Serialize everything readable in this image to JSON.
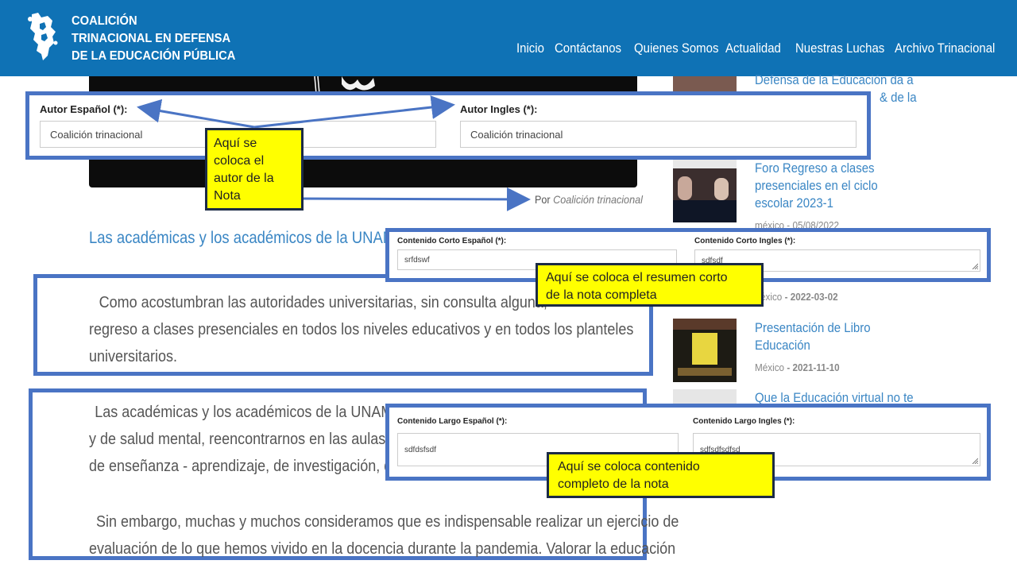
{
  "header": {
    "brand_lines": [
      "COALICIÓN",
      "TRINACIONAL EN DEFENSA",
      "DE LA EDUCACIÓN PÚBLICA"
    ],
    "nav": [
      "Inicio",
      "Contáctanos",
      "Quienes Somos",
      "Actualidad",
      "Nuestras Luchas",
      "Archivo Trinacional"
    ]
  },
  "article": {
    "byline_prefix": "Por",
    "byline_author": "Coalición trinacional",
    "title": "Las académicas y los académicos de la UNAM",
    "para1": [
      "Como acostumbran las autoridades universitarias, sin consulta alguna,",
      "regreso a clases presenciales en todos los niveles educativos y en todos los planteles",
      "universitarios."
    ],
    "para2": [
      "Las académicas y los académicos de la UNAM, s",
      "y de salud mental, reencontrarnos en las aulas y lo",
      "de enseñanza - aprendizaje, de investigación, de di"
    ],
    "para3": [
      "Sin embargo, muchas y muchos consideramos que es indispensable realizar un ejercicio de",
      "evaluación de lo que hemos vivido en la docencia durante la pandemia. Valorar la educación"
    ]
  },
  "sidebar": {
    "item1_lines": [
      "Defensa de la Educación da a",
      "& de la"
    ],
    "item2_lines": [
      "Foro Regreso a clases",
      "presenciales en el ciclo",
      "escolar 2023-1"
    ],
    "item2_meta": "méxico - 05/08/2022",
    "item3_meta_prefix": "éxico",
    "item3_meta_date": "- 2022-03-02",
    "item4_lines": [
      "Presentación de Libro",
      "Educación"
    ],
    "item4_meta_prefix": "México",
    "item4_meta_date": "- 2021-11-10",
    "item5_line": "Que la Educación virtual no te"
  },
  "author_form": {
    "es_label": "Autor Español (*):",
    "es_value": "Coalición trinacional",
    "en_label": "Autor Ingles (*):",
    "en_value": "Coalición trinacional"
  },
  "short_form": {
    "es_label": "Contenido Corto Español (*):",
    "es_value": "srfdswf",
    "en_label": "Contenido Corto Ingles (*):",
    "en_value": "sdfsdf"
  },
  "long_form": {
    "es_label": "Contenido Largo Español (*):",
    "es_value": "sdfdsfsdf",
    "en_label": "Contenido Largo Ingles (*):",
    "en_value": "sdfsdfsdfsd"
  },
  "notes": {
    "author_note": [
      "Aquí  se",
      "coloca el",
      "autor de la",
      "Nota"
    ],
    "short_note": [
      "Aquí  se coloca el resumen corto",
      "de la nota completa"
    ],
    "long_note": [
      "Aquí  se coloca contenido",
      "completo de la nota"
    ]
  },
  "colors": {
    "header": "#0f72b5",
    "box_border": "#4a74c4",
    "note_bg": "#ffff00",
    "link": "#3a86c4"
  }
}
